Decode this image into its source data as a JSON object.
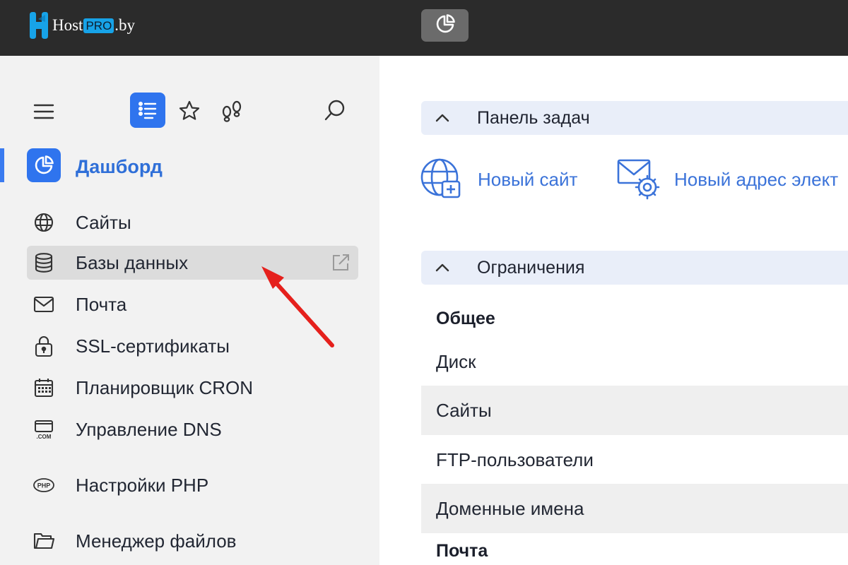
{
  "brand": {
    "name_part1": "Host",
    "name_part2": "PRO",
    "name_part3": ".by",
    "accent": "#2f74ee",
    "logo_blue": "#17a3e8"
  },
  "topbar": {
    "dashboard_button_icon": "pie-chart-icon"
  },
  "sidebar": {
    "toolbar": {
      "menu_icon": "hamburger-icon",
      "list_icon": "list-icon",
      "favorites_icon": "star-icon",
      "footprints_icon": "footprints-icon",
      "search_icon": "search-icon"
    },
    "active_item": {
      "label": "Дашборд",
      "icon": "pie-chart-icon"
    },
    "items": [
      {
        "label": "Сайты",
        "icon": "globe-icon"
      },
      {
        "label": "Базы данных",
        "icon": "database-icon",
        "hovered": true,
        "action_icon": "external-link-icon"
      },
      {
        "label": "Почта",
        "icon": "mail-icon"
      },
      {
        "label": "SSL-сертификаты",
        "icon": "lock-icon"
      },
      {
        "label": "Планировщик CRON",
        "icon": "calendar-icon"
      },
      {
        "label": "Управление DNS",
        "icon": "dns-icon"
      },
      {
        "label": "Настройки PHP",
        "icon": "php-icon"
      },
      {
        "label": "Менеджер файлов",
        "icon": "folder-icon"
      }
    ]
  },
  "main": {
    "task_panel": {
      "title": "Панель задач",
      "actions": [
        {
          "label": "Новый сайт",
          "icon": "globe-plus-icon"
        },
        {
          "label": "Новый адрес элект",
          "icon": "mail-gear-icon"
        }
      ]
    },
    "limits": {
      "title": "Ограничения",
      "rows": [
        {
          "label": "Общее",
          "bold": true
        },
        {
          "label": "Диск"
        },
        {
          "label": "Сайты"
        },
        {
          "label": "FTP-пользователи"
        },
        {
          "label": "Доменные имена"
        },
        {
          "label": "Почта",
          "bold": true
        }
      ]
    }
  },
  "annotation": {
    "arrow_color": "#e5201c"
  }
}
